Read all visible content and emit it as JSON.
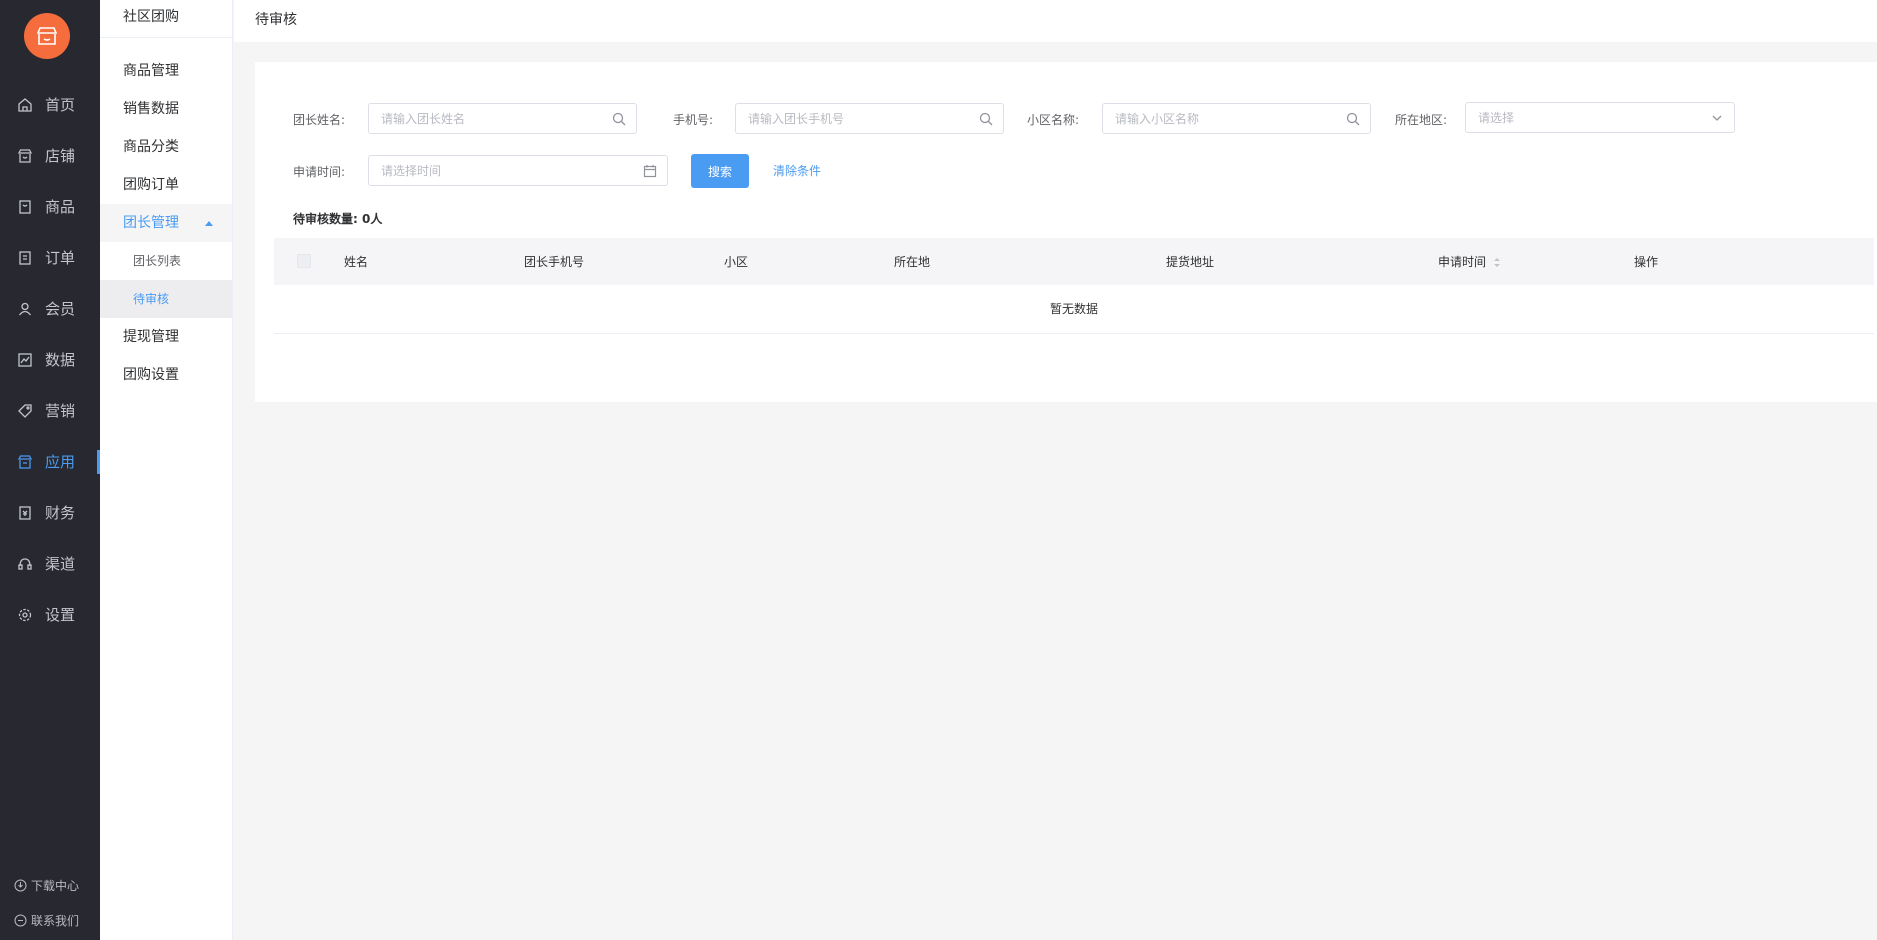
{
  "sidebar": {
    "items": [
      {
        "label": "首页",
        "icon": "home-icon"
      },
      {
        "label": "店铺",
        "icon": "store-icon"
      },
      {
        "label": "商品",
        "icon": "goods-icon"
      },
      {
        "label": "订单",
        "icon": "order-icon"
      },
      {
        "label": "会员",
        "icon": "member-icon"
      },
      {
        "label": "数据",
        "icon": "data-icon"
      },
      {
        "label": "营销",
        "icon": "tag-icon"
      },
      {
        "label": "应用",
        "icon": "app-icon"
      },
      {
        "label": "财务",
        "icon": "finance-icon"
      },
      {
        "label": "渠道",
        "icon": "channel-icon"
      },
      {
        "label": "设置",
        "icon": "gear-icon"
      }
    ],
    "active": "应用",
    "download": "下载中心",
    "contact": "联系我们"
  },
  "subnav": {
    "title": "社区团购",
    "items": [
      "商品管理",
      "销售数据",
      "商品分类",
      "团购订单",
      "团长管理"
    ],
    "children": [
      "团长列表",
      "待审核"
    ],
    "after": [
      "提现管理",
      "团购设置"
    ]
  },
  "header": {
    "title": "待审核"
  },
  "filters": {
    "name": {
      "label": "团长姓名:",
      "placeholder": "请输入团长姓名"
    },
    "phone": {
      "label": "手机号:",
      "placeholder": "请输入团长手机号"
    },
    "community": {
      "label": "小区名称:",
      "placeholder": "请输入小区名称"
    },
    "region": {
      "label": "所在地区:",
      "placeholder": "请选择"
    },
    "time": {
      "label": "申请时间:",
      "placeholder": "请选择时间"
    },
    "search_label": "搜索",
    "clear_label": "清除条件"
  },
  "count": {
    "label": "待审核数量:",
    "value": "0人"
  },
  "table": {
    "columns": [
      "姓名",
      "团长手机号",
      "小区",
      "所在地",
      "提货地址",
      "申请时间",
      "操作"
    ],
    "empty": "暂无数据"
  },
  "colors": {
    "accent": "#4a9bf2",
    "logo": "#f56d3c",
    "sidebar_bg": "#282830"
  }
}
